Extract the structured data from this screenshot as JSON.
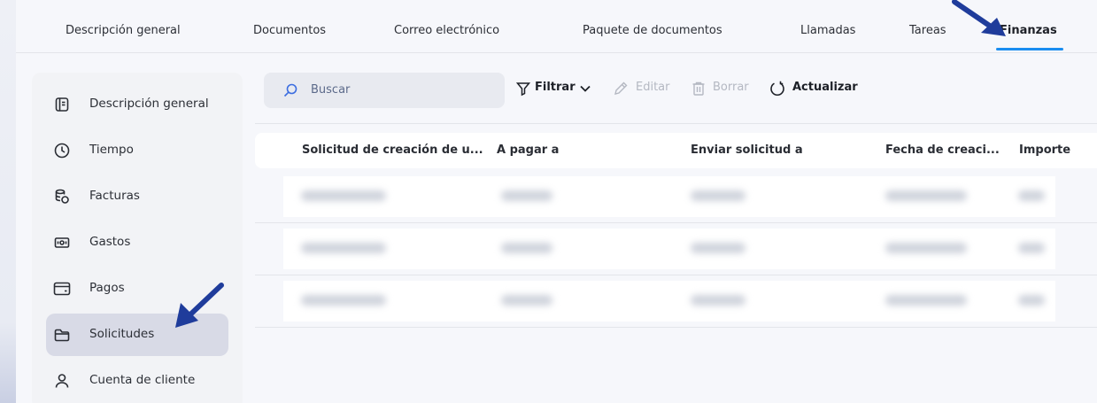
{
  "tabs": [
    {
      "label": "Descripción general"
    },
    {
      "label": "Documentos"
    },
    {
      "label": "Correo electrónico"
    },
    {
      "label": "Paquete de documentos"
    },
    {
      "label": "Llamadas"
    },
    {
      "label": "Tareas"
    },
    {
      "label": "Finanzas",
      "active": true
    }
  ],
  "sidebar": {
    "items": [
      {
        "label": "Descripción general",
        "icon": "overview-icon"
      },
      {
        "label": "Tiempo",
        "icon": "clock-icon"
      },
      {
        "label": "Facturas",
        "icon": "invoice-coins-icon"
      },
      {
        "label": "Gastos",
        "icon": "cash-icon"
      },
      {
        "label": "Pagos",
        "icon": "card-icon"
      },
      {
        "label": "Solicitudes",
        "icon": "folder-icon",
        "active": true
      },
      {
        "label": "Cuenta de cliente",
        "icon": "user-icon"
      }
    ]
  },
  "toolbar": {
    "search_placeholder": "Buscar",
    "filter_label": "Filtrar",
    "edit_label": "Editar",
    "delete_label": "Borrar",
    "refresh_label": "Actualizar"
  },
  "table": {
    "columns": [
      "Solicitud de creación de u...",
      "A pagar a",
      "Enviar solicitud a",
      "Fecha de creaci...",
      "Importe"
    ],
    "row_count": 3
  },
  "colors": {
    "accent": "#1a8df0",
    "annotation_arrow": "#1f3c9b",
    "active_sidebar_bg": "#d8dae6"
  }
}
